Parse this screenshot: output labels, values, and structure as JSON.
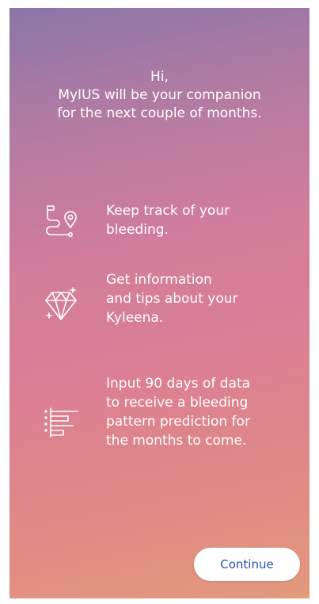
{
  "header": {
    "line1": "Hi,",
    "line2": "MyIUS will be your companion",
    "line3": "for the next couple of months."
  },
  "features": [
    {
      "icon": "route-pin-icon",
      "lines": [
        "Keep track of your",
        "bleeding."
      ]
    },
    {
      "icon": "diamond-icon",
      "lines": [
        "Get information",
        "and tips about your",
        "Kyleena."
      ]
    },
    {
      "icon": "pattern-chart-icon",
      "lines": [
        "Input 90 days of data",
        "to receive a bleeding",
        "pattern prediction for",
        "the months to come."
      ]
    }
  ],
  "continue_label": "Continue"
}
